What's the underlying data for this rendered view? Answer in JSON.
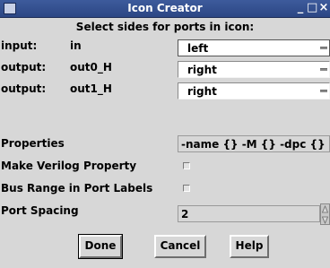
{
  "window": {
    "title": "Icon Creator",
    "minimize_glyph": "_",
    "maximize_glyph": "□",
    "close_glyph": "×"
  },
  "heading": "Select sides for ports in icon:",
  "ports": [
    {
      "kind": "input:",
      "name": "in",
      "side": "left"
    },
    {
      "kind": "output:",
      "name": "out0_H",
      "side": "right"
    },
    {
      "kind": "output:",
      "name": "out1_H",
      "side": "right"
    }
  ],
  "properties": {
    "label": "Properties",
    "value": "-name {} -M {} -dpc {}"
  },
  "make_verilog": {
    "label": "Make Verilog Property",
    "checked": false
  },
  "bus_range": {
    "label": "Bus Range in Port Labels",
    "checked": false
  },
  "port_spacing": {
    "label": "Port Spacing",
    "value": "2"
  },
  "buttons": {
    "done": "Done",
    "cancel": "Cancel",
    "help": "Help"
  }
}
